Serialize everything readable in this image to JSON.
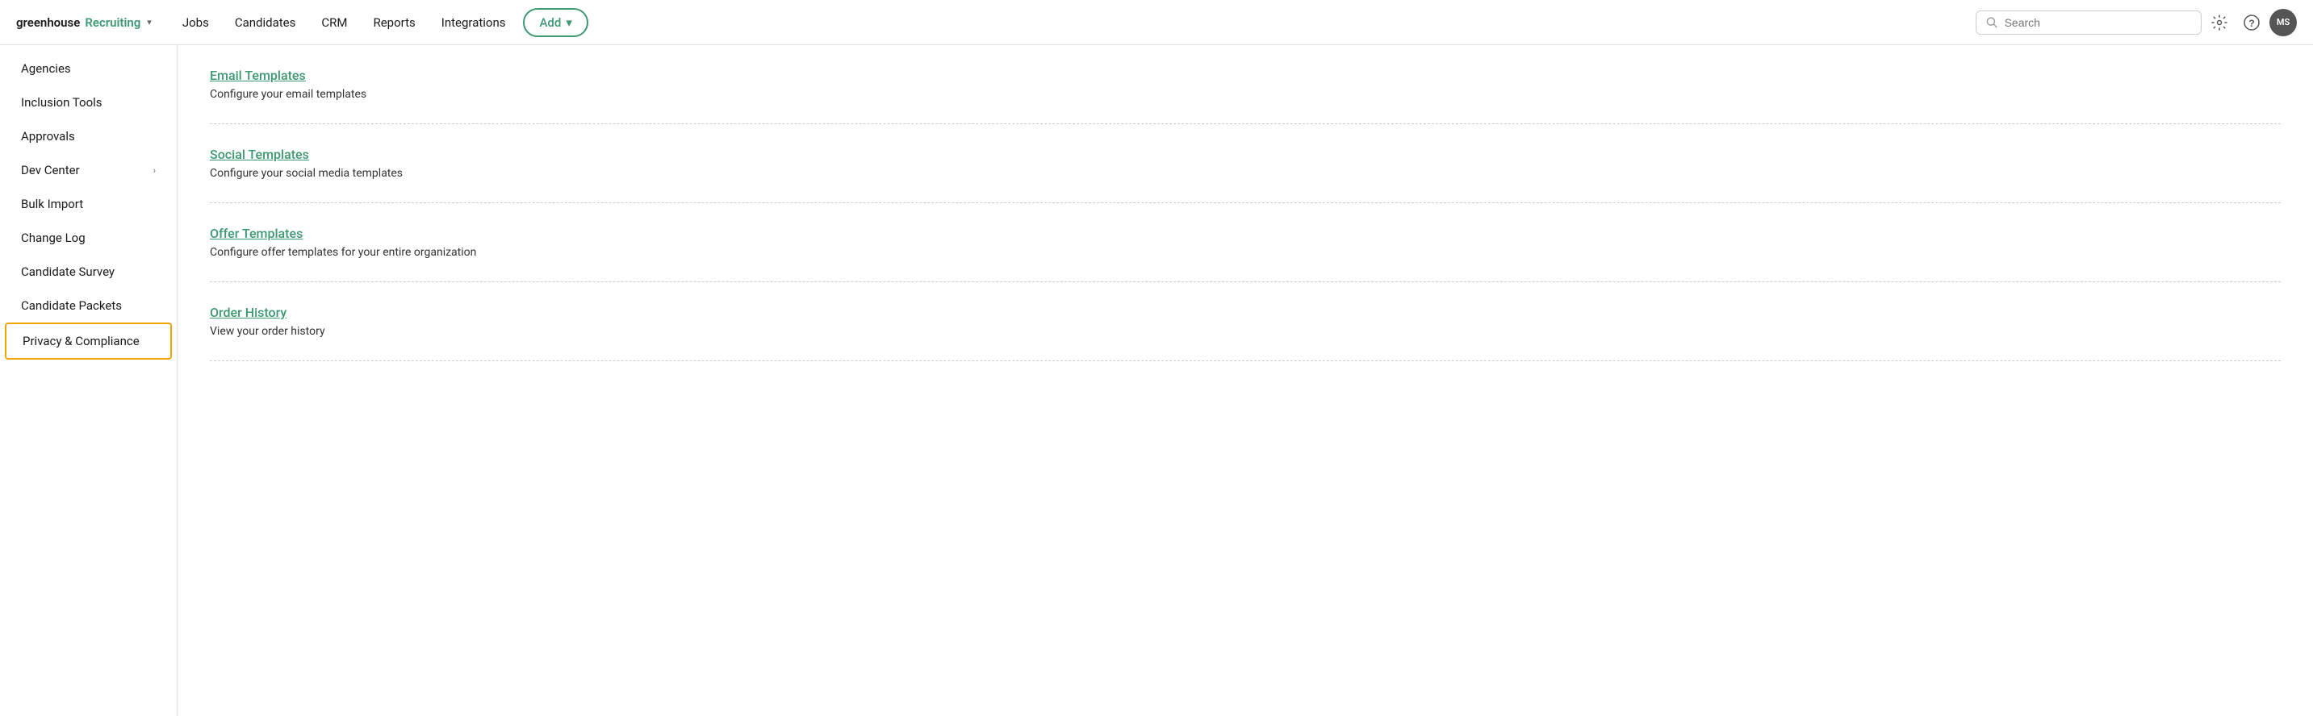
{
  "nav": {
    "logo_greenhouse": "greenhouse",
    "logo_recruiting": "Recruiting",
    "logo_chevron": "▾",
    "links": [
      "Jobs",
      "Candidates",
      "CRM",
      "Reports",
      "Integrations"
    ],
    "add_label": "Add",
    "add_chevron": "▾",
    "search_placeholder": "Search",
    "settings_icon": "⚙",
    "help_icon": "?",
    "avatar_label": "MS"
  },
  "sidebar": {
    "items": [
      {
        "label": "Agencies",
        "has_chevron": false,
        "active": false
      },
      {
        "label": "Inclusion Tools",
        "has_chevron": false,
        "active": false
      },
      {
        "label": "Approvals",
        "has_chevron": false,
        "active": false
      },
      {
        "label": "Dev Center",
        "has_chevron": true,
        "active": false
      },
      {
        "label": "Bulk Import",
        "has_chevron": false,
        "active": false
      },
      {
        "label": "Change Log",
        "has_chevron": false,
        "active": false
      },
      {
        "label": "Candidate Survey",
        "has_chevron": false,
        "active": false
      },
      {
        "label": "Candidate Packets",
        "has_chevron": false,
        "active": false
      },
      {
        "label": "Privacy & Compliance",
        "has_chevron": false,
        "active": true
      }
    ]
  },
  "content": {
    "rows": [
      {
        "link": "Email Templates",
        "description": "Configure your email templates"
      },
      {
        "link": "Social Templates",
        "description": "Configure your social media templates"
      },
      {
        "link": "Offer Templates",
        "description": "Configure offer templates for your entire organization"
      },
      {
        "link": "Order History",
        "description": "View your order history"
      }
    ]
  }
}
